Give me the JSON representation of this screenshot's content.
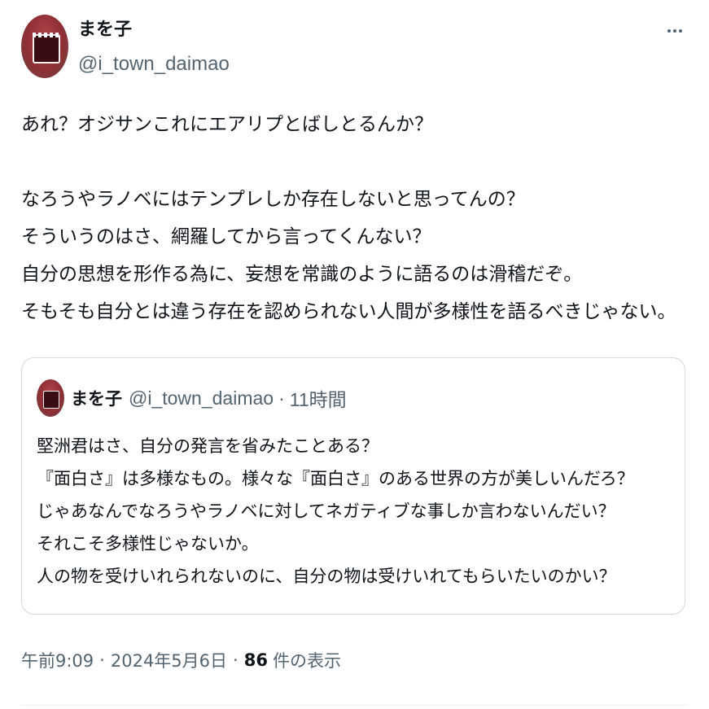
{
  "author": {
    "display_name": "まを子",
    "handle": "@i_town_daimao"
  },
  "more_icon": "more-horizontal-icon",
  "tweet_lines": [
    "あれ？オジサンこれにエアリプとばしとるんか？",
    "",
    "なろうやラノベにはテンプレしか存在しないと思ってんの？",
    "そういうのはさ、網羅してから言ってくんない？",
    "自分の思想を形作る為に、妄想を常識のように語るのは滑稽だぞ。",
    "そもそも自分とは違う存在を認められない人間が多様性を語るべきじゃない。"
  ],
  "quoted": {
    "display_name": "まを子",
    "handle": "@i_town_daimao",
    "dot": "·",
    "time": "11時間",
    "lines": [
      "堅洲君はさ、自分の発言を省みたことある？",
      "『面白さ』は多様なもの。様々な『面白さ』のある世界の方が美しいんだろ？",
      "じゃあなんでなろうやラノベに対してネガティブな事しか言わないんだい？",
      "それこそ多様性じゃないか。",
      "人の物を受けいれられないのに、自分の物は受けいれてもらいたいのかい？"
    ]
  },
  "meta": {
    "time": "午前9:09",
    "sep": "·",
    "date": "2024年5月6日",
    "view_count": "86",
    "view_label": "件の表示"
  },
  "colors": {
    "text": "#0f1419",
    "secondary": "#536471",
    "border": "#cfd9de"
  }
}
